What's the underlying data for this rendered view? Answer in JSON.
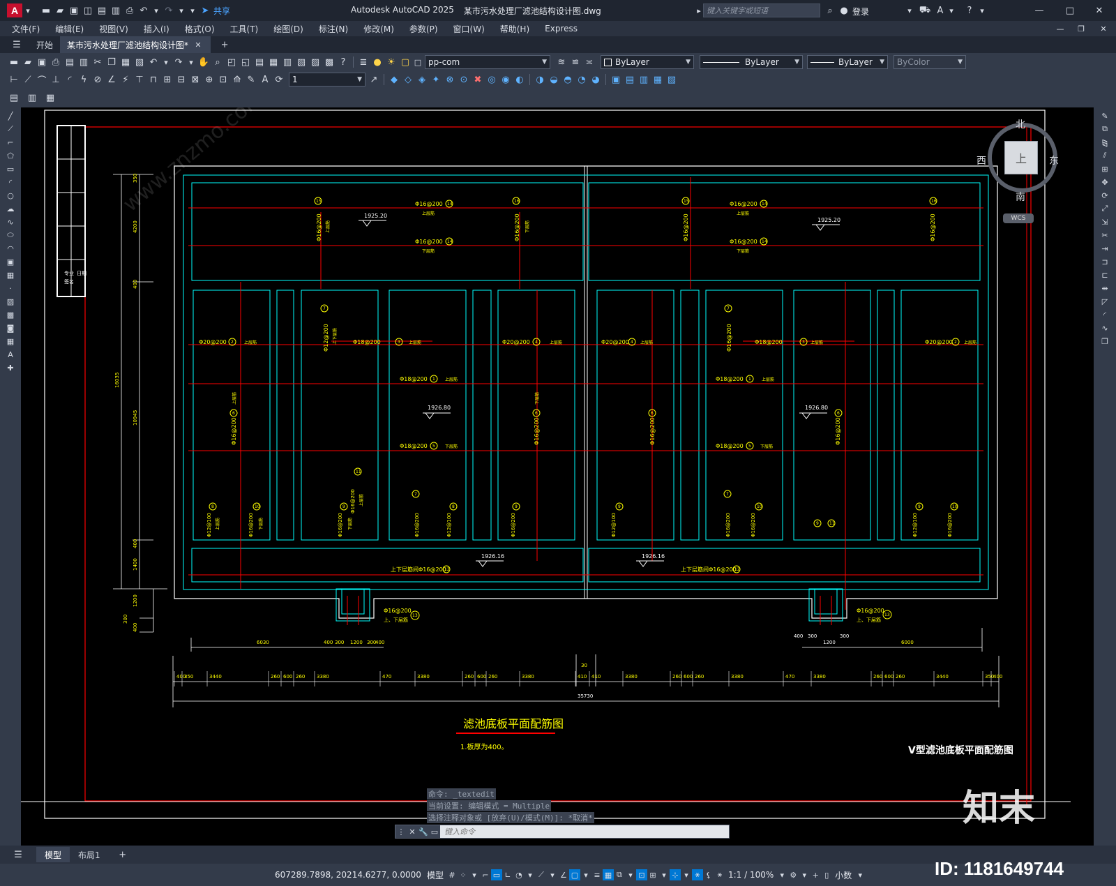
{
  "app": {
    "title": "Autodesk AutoCAD 2025",
    "doc_title": "某市污水处理厂滤池结构设计图.dwg",
    "share": "共享",
    "search_placeholder": "键入关键字或短语",
    "login": "登录"
  },
  "menu": [
    "文件(F)",
    "编辑(E)",
    "视图(V)",
    "插入(I)",
    "格式(O)",
    "工具(T)",
    "绘图(D)",
    "标注(N)",
    "修改(M)",
    "参数(P)",
    "窗口(W)",
    "帮助(H)",
    "Express"
  ],
  "tabs": {
    "start": "开始",
    "active": "某市污水处理厂滤池结构设计图*"
  },
  "toolbar": {
    "layer": "pp-com",
    "color": "ByLayer",
    "linetype": "ByLayer",
    "lineweight": "ByLayer",
    "plotstyle": "ByColor",
    "dimscale": "1"
  },
  "viewcube": {
    "north": "北",
    "south": "南",
    "east": "东",
    "west": "西",
    "top": "上",
    "wcs": "WCS"
  },
  "drawing": {
    "title": "滤池底板平面配筋图",
    "note": "1.板厚为400。",
    "frame_title": "V型滤池底板平面配筋图",
    "elevations": [
      "1925.20",
      "1925.20",
      "1926.80",
      "1926.80",
      "1926.16",
      "1926.16"
    ],
    "rebar_labels": {
      "r14": "Φ16@200",
      "r14_num": "14",
      "r14_side": "上层筋",
      "r14b_side": "下层筋",
      "r15": "Φ16@200",
      "r15_num": "15",
      "r15_side": "上层筋",
      "r16": "Φ16@200",
      "r16_num": "16",
      "r16_side": "下层筋",
      "r2": "Φ20@200",
      "r2_num": "2",
      "r2_side": "上层筋",
      "r4": "Φ20@200",
      "r4_num": "4",
      "r4_side": "上层筋",
      "r3": "Φ18@200",
      "r3_num": "3",
      "r3_side": "上层筋",
      "r1": "Φ18@200",
      "r1_num": "1",
      "r1_side": "上层筋",
      "r5": "Φ18@200",
      "r5_num": "5",
      "r5_side": "下层筋",
      "r6": "Φ16@200",
      "r6_num": "6",
      "r6_side": "上层筋",
      "r6b_side": "下层筋",
      "r7": "Φ12@200",
      "r7b": "Φ16@200",
      "r7_num": "7",
      "r7_side": "上下层筋",
      "r8": "Φ12@100",
      "r8b": "Φ16@100",
      "r8_num": "8",
      "r8_side": "上层筋",
      "r9": "Φ16@200",
      "r9_num": "9",
      "r9_side": "下层筋",
      "r10": "Φ16@200",
      "r10_num": "10",
      "r10_side": "下层筋",
      "r11": "Φ16@200",
      "r11_num": "11",
      "r11_side": "上层筋",
      "r12": "上下层筋间Φ16@200",
      "r12_num": "12",
      "r13": "Φ16@200",
      "r13_num": "13",
      "r13_side": "上、下层筋"
    },
    "dims_top_left": [
      "6030",
      "400",
      "300",
      "1200",
      "300",
      "400"
    ],
    "dims_top_right": [
      "400",
      "300",
      "1200",
      "300",
      "6000"
    ],
    "dims_row": [
      "400",
      "350",
      "3440",
      "260",
      "600",
      "260",
      "3380",
      "470",
      "3380",
      "260",
      "600",
      "260",
      "3380",
      "410",
      "410",
      "3380",
      "260",
      "600",
      "260",
      "3380",
      "470",
      "3380",
      "260",
      "600",
      "260",
      "3440",
      "350",
      "400"
    ],
    "dim_30": "30",
    "dim_total": "35730",
    "dims_vertical": [
      "350",
      "4200",
      "400",
      "400",
      "1400",
      "1200",
      "300",
      "400"
    ],
    "dim_v_total": "16035",
    "dim_v_mid": "10945",
    "table_text": [
      "专业",
      "签名",
      "日期"
    ]
  },
  "command": {
    "history": [
      "命令: _textedit",
      "当前设置: 编辑模式 = Multiple",
      "选择注释对象或 [放弃(U)/模式(M)]: *取消*"
    ],
    "placeholder": "键入命令"
  },
  "layout_tabs": [
    "模型",
    "布局1"
  ],
  "status": {
    "coords": "607289.7898, 20214.6277, 0.0000",
    "space": "模型",
    "scale": "1:1 / 100%",
    "units": "小数"
  },
  "watermark": {
    "brand": "知末",
    "id": "ID: 1181649744",
    "url": "www.znzmo.com"
  },
  "colors": {
    "accent": "#0078d4",
    "canvas": "#000000",
    "rebar_red": "#ff0000",
    "outline_cyan": "#00ffff",
    "text_yellow": "#ffff00"
  }
}
